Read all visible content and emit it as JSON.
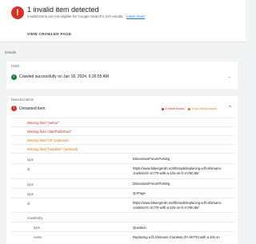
{
  "alert": {
    "title": "1 invalid item detected",
    "subtitle": "Invalid items are not eligible for Google Search's rich results.",
    "learn_more": "Learn more",
    "view_button": "VIEW CRAWLED PAGE"
  },
  "details_label": "Details",
  "fetch": {
    "header": "Fetch",
    "status": "Crawled successfully on Jan 18, 2024, 6:26:55 AM"
  },
  "detected": {
    "header": "Detected items",
    "item_label": "Unnamed item",
    "critical_badge": "2 critical issues",
    "noncritical_badge": "2 non-critical issues",
    "issues": [
      {
        "text": "Missing field \"author\"",
        "level": "critical"
      },
      {
        "text": "Missing field \"datePublished\"",
        "level": "critical"
      },
      {
        "text": "Missing field \"url\" (optional)",
        "level": "noncritical"
      },
      {
        "text": "Missing field \"headline\" (optional)",
        "level": "noncritical"
      }
    ],
    "rows": [
      {
        "key": "type",
        "value": "DiscussionForumPosting"
      },
      {
        "key": "id",
        "value": "https://www.bikeegenlin.net/threads/replacing-a-fb-shimano-crankset-fc-m770-with-a-10s-on-fc-m780.88/"
      },
      {
        "key": "type",
        "value": "DiscussionForumPosting"
      },
      {
        "key": "type",
        "value": "QAPage"
      },
      {
        "key": "id",
        "value": "https://www.bikeegenlin.net/threads/replacing-a-fb-shimano-crankset-fc-m770-with-a-10s-on-fc-m780.88/"
      }
    ],
    "main_entity_key": "mainEntity",
    "main_entity_rows": [
      {
        "key": "type",
        "value": "Question"
      },
      {
        "key": "name",
        "value": "Replacing a fb Shimano Crankset (Fc-M770) with a 10s on"
      }
    ]
  }
}
